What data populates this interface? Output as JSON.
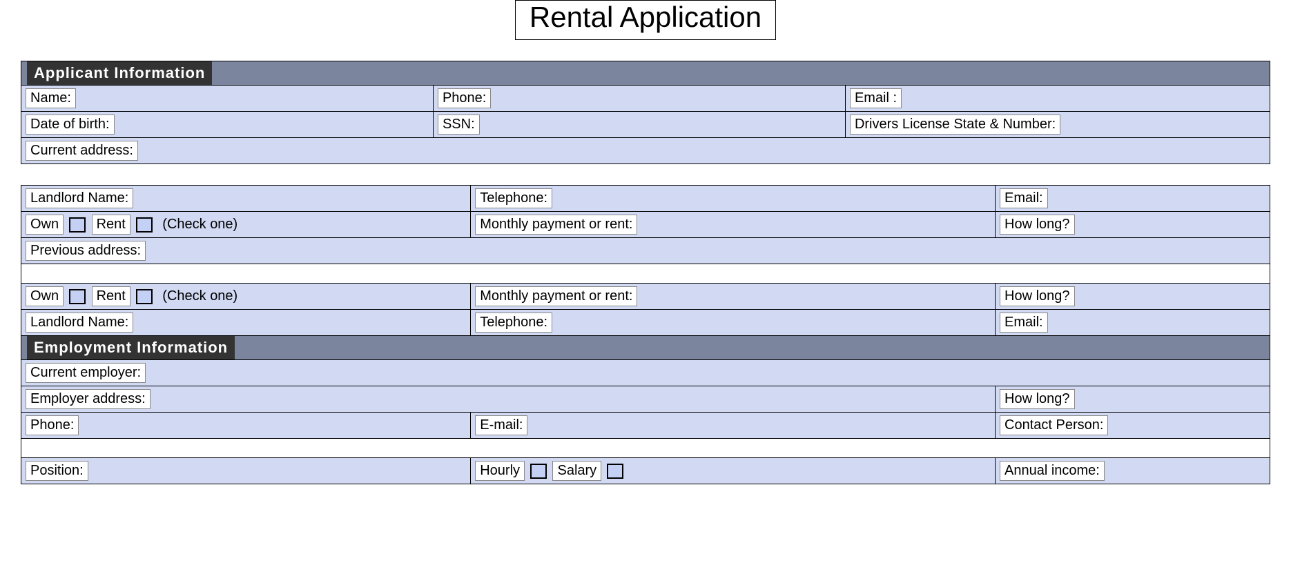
{
  "title": "Rental Application",
  "sections": {
    "applicant": {
      "header": "Applicant Information",
      "labels": {
        "name": "Name:",
        "phone": "Phone:",
        "email": "Email :",
        "dob": "Date of birth:",
        "ssn": "SSN:",
        "dlnum": "Drivers License State & Number:",
        "current_address": "Current address:",
        "landlord_name": "Landlord Name:",
        "telephone": "Telephone:",
        "email2": "Email:",
        "own": "Own",
        "rent": "Rent",
        "check_one": "(Check one)",
        "monthly_payment": "Monthly payment or rent:",
        "how_long": "How long?",
        "previous_address": "Previous address:"
      }
    },
    "employment": {
      "header": "Employment Information",
      "labels": {
        "current_employer": "Current employer:",
        "employer_address": "Employer address:",
        "how_long": "How long?",
        "phone": "Phone:",
        "email": "E-mail:",
        "contact_person": "Contact Person:",
        "position": "Position:",
        "hourly": "Hourly",
        "salary": "Salary",
        "annual_income": "Annual income:"
      }
    }
  }
}
